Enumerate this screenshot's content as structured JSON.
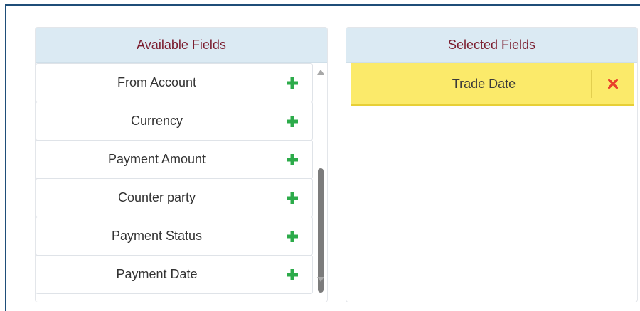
{
  "available": {
    "title": "Available Fields",
    "items": [
      {
        "label": "From Account"
      },
      {
        "label": "Currency"
      },
      {
        "label": "Payment Amount"
      },
      {
        "label": "Counter party"
      },
      {
        "label": "Payment Status"
      },
      {
        "label": "Payment Date"
      }
    ],
    "add_icon": "plus-icon",
    "add_color": "#2cab4a"
  },
  "selected": {
    "title": "Selected Fields",
    "items": [
      {
        "label": "Trade Date"
      }
    ],
    "remove_icon": "close-icon",
    "remove_color": "#e8402b",
    "highlight_color": "#fbea6a"
  }
}
